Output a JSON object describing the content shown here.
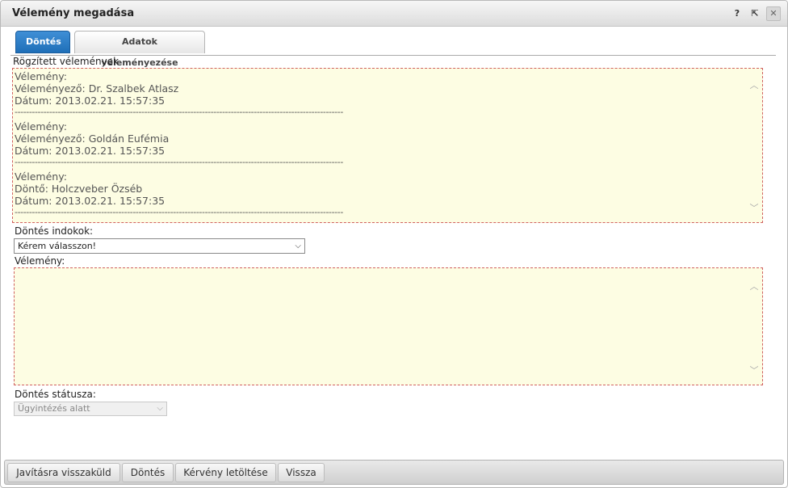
{
  "window": {
    "title": "Vélemény megadása",
    "help_icon": "?",
    "popout_icon": "⇱",
    "close_icon": "✕"
  },
  "tabs": [
    {
      "label": "Döntés",
      "active": true
    },
    {
      "label": "Adatok véleményezése",
      "active": false
    }
  ],
  "recorded": {
    "label": "Rögzített vélemények",
    "entries": [
      {
        "line1": "Vélemény:",
        "line2": "Véleményező: Dr. Szalbek Atlasz",
        "line3": "Dátum: 2013.02.21. 15:57:35"
      },
      {
        "line1": "Vélemény:",
        "line2": "Véleményező: Goldán Eufémia",
        "line3": "Dátum: 2013.02.21. 15:57:35"
      },
      {
        "line1": "Vélemény:",
        "line2": "Döntő: Holczveber Özséb",
        "line3": "Dátum: 2013.02.21. 15:57:35"
      }
    ],
    "separator": "------------------------------------------------------------------------------------------------------------------"
  },
  "reasons": {
    "label": "Döntés indokok:",
    "selected": "Kérem válasszon!"
  },
  "opinion": {
    "label": "Vélemény:",
    "value": ""
  },
  "status": {
    "label": "Döntés státusza:",
    "selected": "Ügyintézés alatt"
  },
  "footer": {
    "return_label": "Javításra visszaküld",
    "decide_label": "Döntés",
    "download_label": "Kérvény letöltése",
    "back_label": "Vissza"
  },
  "icons": {
    "scroll_up": "︿",
    "scroll_down": "﹀",
    "dropdown": "⌵"
  }
}
